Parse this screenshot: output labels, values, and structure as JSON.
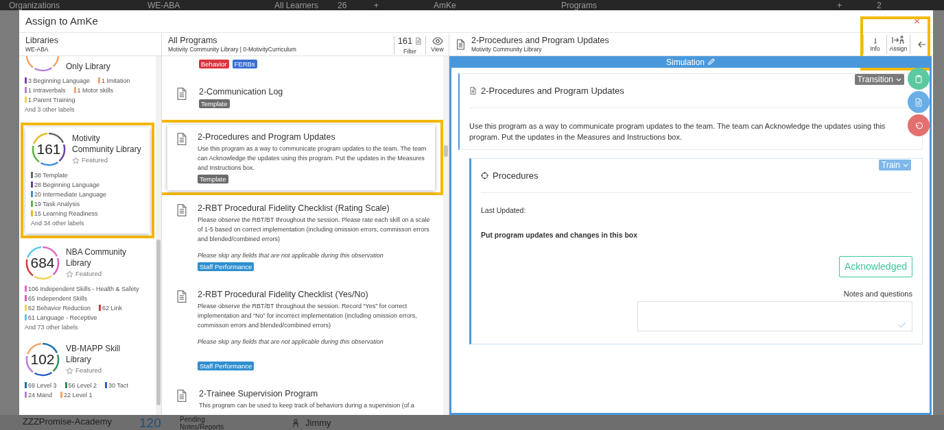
{
  "background": {
    "top_bar": [
      "Organizations",
      "WE-ABA",
      "All Learners",
      "26",
      "+",
      "AmKe",
      "Programs",
      "+",
      "2"
    ],
    "bottom_bar": [
      "ZZZPromise-Academy",
      "120",
      "Pending",
      "Notes/Reports",
      "Jimmy"
    ]
  },
  "dialog": {
    "title": "Assign to AmKe",
    "close": "×"
  },
  "libraries": {
    "title": "Libraries",
    "subtitle": "WE-ABA",
    "items": [
      {
        "title": "Only Library",
        "selected": false,
        "highlighted": false,
        "labels": [
          {
            "text": "3 Beginning Language",
            "color": "#7b3fb0"
          },
          {
            "text": "1 Imitation",
            "color": "#f4a56a"
          },
          {
            "text": "1 Intraverbals",
            "color": "#b57fd9"
          },
          {
            "text": "1 Motor skills",
            "color": "#f4a56a"
          },
          {
            "text": "1 Parent Training",
            "color": "#f5d14e"
          }
        ],
        "more": "And 3 other labels"
      },
      {
        "title": "Motivity Community Library",
        "count": "161",
        "featured": "Featured",
        "selected": true,
        "highlighted": true,
        "labels": [
          {
            "text": "38 Template",
            "color": "#666666"
          },
          {
            "text": "28 Beginning Language",
            "color": "#6a3ea1"
          },
          {
            "text": "20 Intermediate Language",
            "color": "#3a8fd9"
          },
          {
            "text": "19 Task Analysis",
            "color": "#5cb443"
          },
          {
            "text": "15 Learning Readiness",
            "color": "#e8b923"
          }
        ],
        "more": "And 34 other labels"
      },
      {
        "title": "NBA Community Library",
        "count": "684",
        "featured": "Featured",
        "selected": false,
        "highlighted": false,
        "labels": [
          {
            "text": "106 Independent Skills - Health & Safety",
            "color": "#e06bc4"
          },
          {
            "text": "65 Independent Skills",
            "color": "#e05cb8"
          },
          {
            "text": "62 Behavior Reduction",
            "color": "#f5d14e"
          },
          {
            "text": "62 Link",
            "color": "#d93a3a"
          },
          {
            "text": "61 Language - Receptive",
            "color": "#5bc8f0"
          }
        ],
        "more": "And 73 other labels"
      },
      {
        "title": "VB-MAPP Skill Library",
        "count": "102",
        "featured": "Featured",
        "selected": false,
        "highlighted": false,
        "labels": [
          {
            "text": "69 Level 3",
            "color": "#1f6fa8"
          },
          {
            "text": "56 Level 2",
            "color": "#2f8f5a"
          },
          {
            "text": "30 Tact",
            "color": "#2a5cc9"
          },
          {
            "text": "24 Mand",
            "color": "#b57fd9"
          },
          {
            "text": "22 Level 1",
            "color": "#f4a56a"
          }
        ]
      }
    ]
  },
  "programs": {
    "title": "All Programs",
    "subtitle": "Motivity Community Library | 0-MotivityCurriculum",
    "count": "161",
    "filter": "Filter",
    "view": "View",
    "items": [
      {
        "selected": false,
        "highlighted": false,
        "tags": [
          {
            "text": "Behavior",
            "color": "#d9363e"
          },
          {
            "text": "FERBs",
            "color": "#3b6fd1"
          }
        ]
      },
      {
        "title": "2-Communication Log",
        "selected": false,
        "highlighted": false,
        "tags": [
          {
            "text": "Template",
            "color": "#6b6b6b"
          }
        ]
      },
      {
        "title": "2-Procedures and Program Updates",
        "description": "Use this program as a way to communicate program updates to the team. The team can Acknowledge the updates using this program. Put the updates in the Measures and Instructions box.",
        "selected": true,
        "highlighted": true,
        "tags": [
          {
            "text": "Template",
            "color": "#6b6b6b"
          }
        ]
      },
      {
        "title": "2-RBT Procedural Fidelity Checklist (Rating Scale)",
        "description": "Please observe the RBT/BT throughout the session. Please rate each skill on a scale of 1-5 based on correct implementation (including omission errors, commisson errors and blended/combined errors)",
        "note": "Please skip any fields that are not applicable during this observation",
        "selected": false,
        "highlighted": false,
        "tags": [
          {
            "text": "Staff Performance",
            "color": "#2f8fd0"
          }
        ]
      },
      {
        "title": "2-RBT Procedural Fidelity Checklist (Yes/No)",
        "description": "Please observe the RBT/BT throughout the session. Record “Yes” for correct implementation and “No” for incorrect implementation (including omission errors, commisson errors and blended/combined errors)",
        "note": "Please skip any fields that are not applicable during this observation",
        "selected": false,
        "highlighted": false,
        "tags": [
          {
            "text": "Staff Performance",
            "color": "#2f8fd0"
          }
        ]
      },
      {
        "title": "2-Trainee Supervision Program",
        "description": "This program can be used to keep track of behaviors during a supervision (of a",
        "selected": false,
        "highlighted": false
      }
    ]
  },
  "detail": {
    "title": "2-Procedures and Program Updates",
    "subtitle": "Motivity Community Library",
    "actions_highlighted": true,
    "actions": [
      {
        "kind": "info",
        "label": "Info"
      },
      {
        "kind": "assign",
        "label": "Assign"
      },
      {
        "kind": "back"
      }
    ],
    "mode": "Simulation",
    "sections": [
      {
        "kind": "overview",
        "title": "2-Procedures and Program Updates",
        "dropdown": "Transition",
        "text": "Use this program as a way to communicate program updates to the team. The team can Acknowledge the updates using this program. Put the updates in the Measures and Instructions box."
      },
      {
        "kind": "procedure",
        "title": "Procedures",
        "dropdown": "Train",
        "last_updated": "Last Updated:",
        "instruction": "Put program updates and changes in this box",
        "button": "Acknowledged",
        "notes_label": "Notes and questions"
      }
    ],
    "floating_buttons": [
      {
        "kind": "clipboard",
        "color": "#5cc9a0"
      },
      {
        "kind": "document",
        "color": "#6aaee6"
      },
      {
        "kind": "undo",
        "color": "#e36f6f"
      }
    ]
  }
}
